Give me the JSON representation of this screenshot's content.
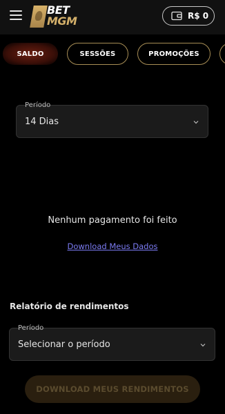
{
  "header": {
    "logo": {
      "line1": "BET",
      "line2": "MGM"
    },
    "balance": "R$ 0",
    "icons": {
      "menu": "hamburger-menu-icon",
      "wallet": "wallet-icon"
    }
  },
  "tabs": [
    {
      "label": "SALDO",
      "active": true
    },
    {
      "label": "SESSÕES",
      "active": false
    },
    {
      "label": "PROMOÇÕES",
      "active": false
    }
  ],
  "period_filter": {
    "label": "Período",
    "value": "14 Dias"
  },
  "empty_state": {
    "message": "Nenhum pagamento foi feito",
    "download_link": "Download Meus Dados"
  },
  "earnings_report": {
    "title": "Relatório de rendimentos",
    "period_label": "Período",
    "period_placeholder": "Selecionar o período",
    "download_button": "DOWNLOAD MEUS RENDIMENTOS"
  },
  "colors": {
    "background": "#000000",
    "header": "#111111",
    "accent_gold": "#a98f56",
    "link": "#7b7bf2",
    "active_tab": "#6a1e10",
    "disabled_button": "#2a1f0f"
  }
}
